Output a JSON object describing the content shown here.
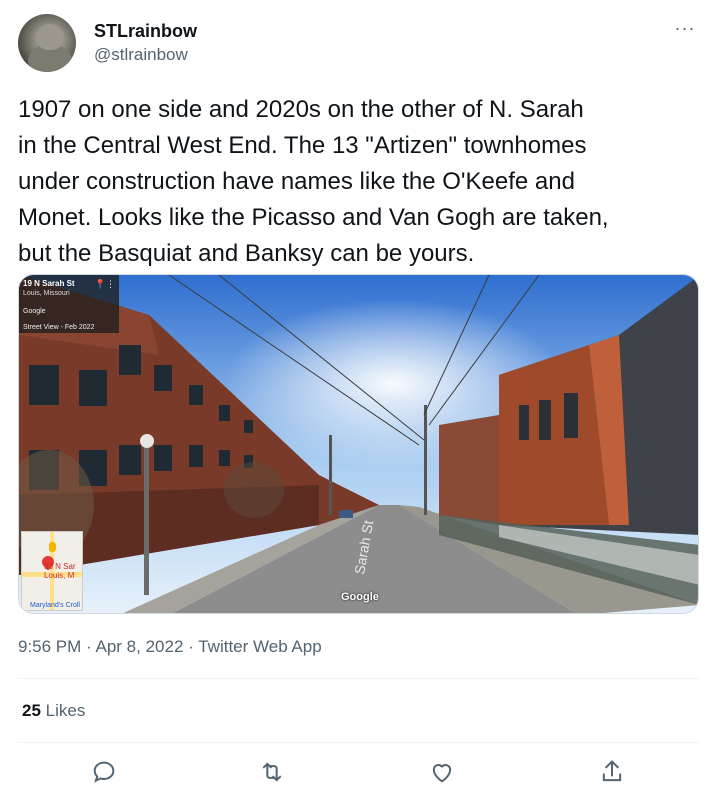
{
  "tweet": {
    "display_name": "STLrainbow",
    "handle": "@stlrainbow",
    "more_label": "···",
    "text": "1907 on one side and 2020s on the other of N. Sarah\nin the Central West End.  The 13 \"Artizen\" townhomes\nunder construction have names like the O'Keefe and\nMonet. Looks like the Picasso and Van Gogh are taken,\nbut the Basquiat and Banksy can be yours.",
    "time": "9:56 PM",
    "date": "Apr 8, 2022",
    "source": "Twitter Web App",
    "likes_count": "25",
    "likes_label": "Likes"
  },
  "media": {
    "street_view_title": "19 N Sarah St",
    "street_view_sub": "Louis, Missouri",
    "street_view_brand": "Google",
    "street_view_date": "Street View - Feb 2022",
    "minimap_label": "33 N Sar Louis, M",
    "minimap_bottom": "Maryland's Croll",
    "watermark": "Google"
  },
  "icons": {
    "reply": "reply-icon",
    "retweet": "retweet-icon",
    "like": "like-icon",
    "share": "share-icon"
  },
  "colors": {
    "text_primary": "#0f1419",
    "text_secondary": "#536471",
    "divider": "#eff3f4"
  }
}
